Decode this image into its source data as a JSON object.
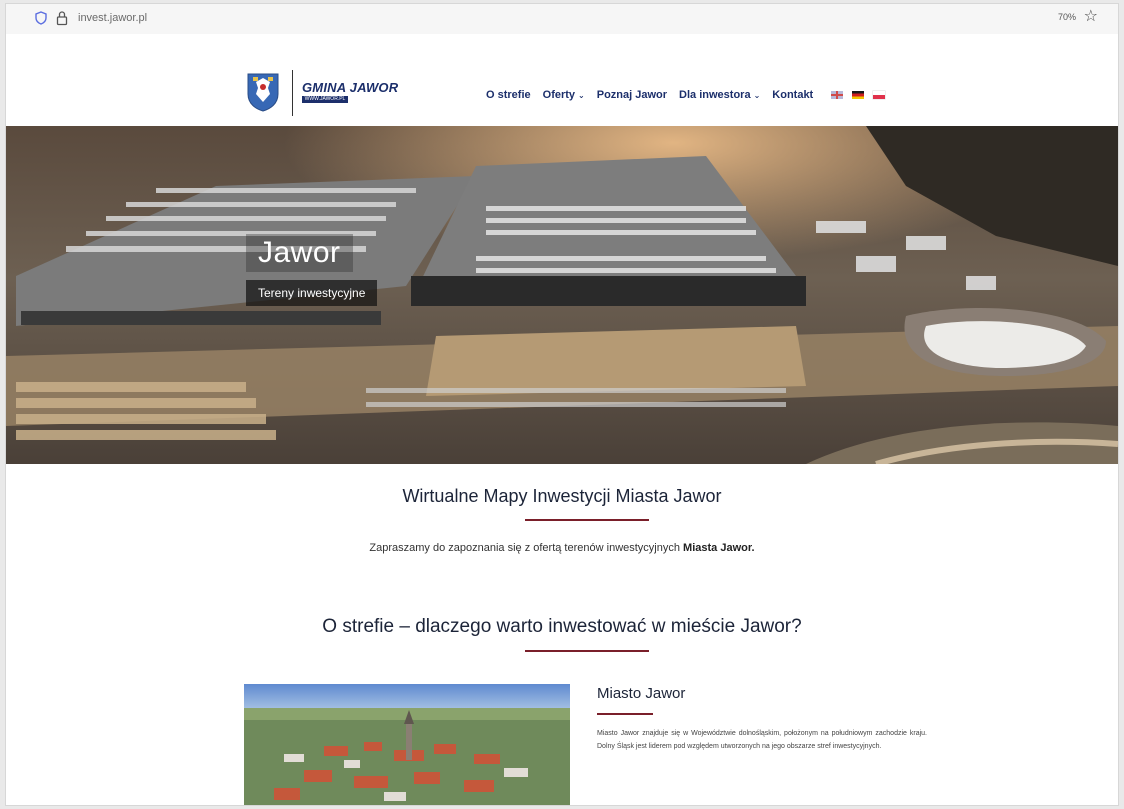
{
  "browser": {
    "url": "invest.jawor.pl",
    "zoom": "70%",
    "bookmark_icon": "star-outline-icon"
  },
  "header": {
    "brand": "GMINA JAWOR",
    "brand_sub": "WWW.JAWOR.PL",
    "crest_icon": "jawor-crest-icon",
    "nav": [
      {
        "label": "O strefie"
      },
      {
        "label": "Oferty",
        "chevron": "⌄"
      },
      {
        "label": "Poznaj Jawor"
      },
      {
        "label": "Dla inwestora",
        "chevron": "⌄"
      },
      {
        "label": "Kontakt"
      }
    ],
    "languages": [
      "uk-flag-icon",
      "de-flag-icon",
      "pl-flag-icon"
    ]
  },
  "hero": {
    "title": "Jawor",
    "subtitle": "Tereny inwestycyjne"
  },
  "section1": {
    "title": "Wirtualne Mapy Inwestycji Miasta Jawor",
    "text_prefix": "Zapraszamy do zapoznania się z ofertą terenów inwestycyjnych ",
    "text_bold": "Miasta Jawor."
  },
  "section2": {
    "title": "O strefie – dlaczego warto inwestować w mieście Jawor?",
    "card_title": "Miasto Jawor",
    "card_text": "Miasto Jawor znajduje się w Województwie dolnośląskim, położonym na południowym zachodzie kraju. Dolny Śląsk jest liderem pod względem utworzonych na jego obszarze stref inwestycyjnych."
  },
  "colors": {
    "brand_navy": "#1c2f6b",
    "accent_rule": "#7a1f2a",
    "heading": "#1c2438"
  }
}
